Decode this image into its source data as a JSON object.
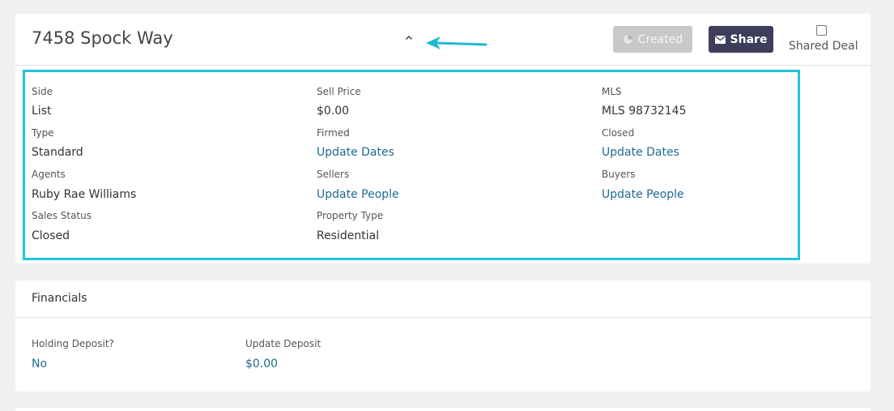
{
  "property": {
    "title": "7458 Spock Way",
    "created_label": "Created",
    "share_label": "Share",
    "shared_deal_label": "Shared Deal"
  },
  "details": {
    "side_label": "Side",
    "side_value": "List",
    "type_label": "Type",
    "type_value": "Standard",
    "agents_label": "Agents",
    "agents_value": "Ruby Rae Williams",
    "sales_status_label": "Sales Status",
    "sales_status_value": "Closed",
    "sell_price_label": "Sell Price",
    "sell_price_value": "$0.00",
    "firmed_label": "Firmed",
    "firmed_value": "Update Dates",
    "sellers_label": "Sellers",
    "sellers_value": "Update People",
    "property_type_label": "Property Type",
    "property_type_value": "Residential",
    "mls_label": "MLS",
    "mls_value": "MLS 98732145",
    "closed_label": "Closed",
    "closed_value": "Update Dates",
    "buyers_label": "Buyers",
    "buyers_value": "Update People"
  },
  "financials": {
    "title": "Financials",
    "holding_deposit_label": "Holding Deposit?",
    "holding_deposit_value": "No",
    "update_deposit_label": "Update Deposit",
    "update_deposit_value": "$0.00"
  },
  "colors": {
    "highlight": "#21c4dc",
    "link": "#1f6a92",
    "share_button": "#3e3d5c",
    "created_button": "#c8c8c8"
  },
  "icons": {
    "caret": "chevron-up-icon",
    "annotation": "arrow-left-icon",
    "created": "pie-chart-icon",
    "share": "envelope-icon"
  }
}
